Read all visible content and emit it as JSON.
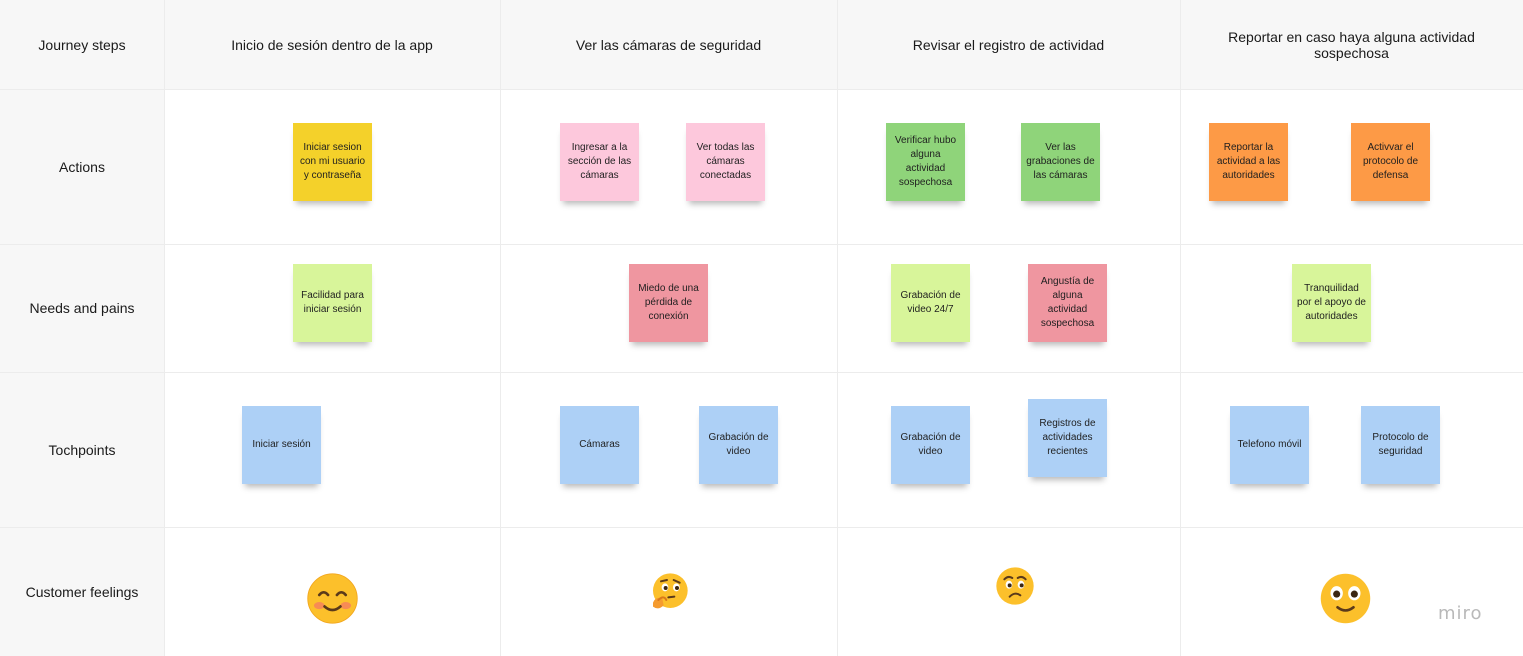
{
  "board": {
    "row_labels": {
      "journey_steps": "Journey steps",
      "actions": "Actions",
      "needs_pains": "Needs and pains",
      "touchpoints": "Tochpoints",
      "feelings": "Customer feelings"
    },
    "steps": [
      "Inicio de sesión dentro de la app",
      "Ver las cámaras de seguridad",
      "Revisar el registro de actividad",
      "Reportar en caso haya alguna actividad sospechosa"
    ],
    "actions": [
      "Iniciar sesion con mi usuario y contraseña",
      "Ingresar a la sección de las cámaras",
      "Ver todas las cámaras conectadas",
      "Verificar hubo alguna actividad sospechosa",
      "Ver las grabaciones de las cámaras",
      "Reportar la actividad a las autoridades",
      "Activvar el protocolo de defensa"
    ],
    "needs_pains": [
      "Facilidad para iniciar sesión",
      "Miedo de una pérdida de conexión",
      "Grabación de video 24/7",
      "Angustía de alguna actividad sospechosa",
      "Tranquilidad por el apoyo de autoridades"
    ],
    "touchpoints": [
      "Iniciar sesión",
      "Cámaras",
      "Grabación de video",
      "Grabación de video",
      "Registros de actividades recientes",
      "Telefono móvil",
      "Protocolo de seguridad"
    ],
    "feelings": [
      "smiling-face-icon",
      "thinking-face-icon",
      "worried-face-icon",
      "wide-eyed-smiling-face-icon"
    ]
  },
  "brand": {
    "logo_text": "miro"
  },
  "colors": {
    "yellow": "#f4d12a",
    "pink": "#fdc8dc",
    "green": "#8fd47a",
    "orange": "#fd9a46",
    "lime": "#d8f59a",
    "red": "#ef96a0",
    "blue": "#add0f6"
  }
}
